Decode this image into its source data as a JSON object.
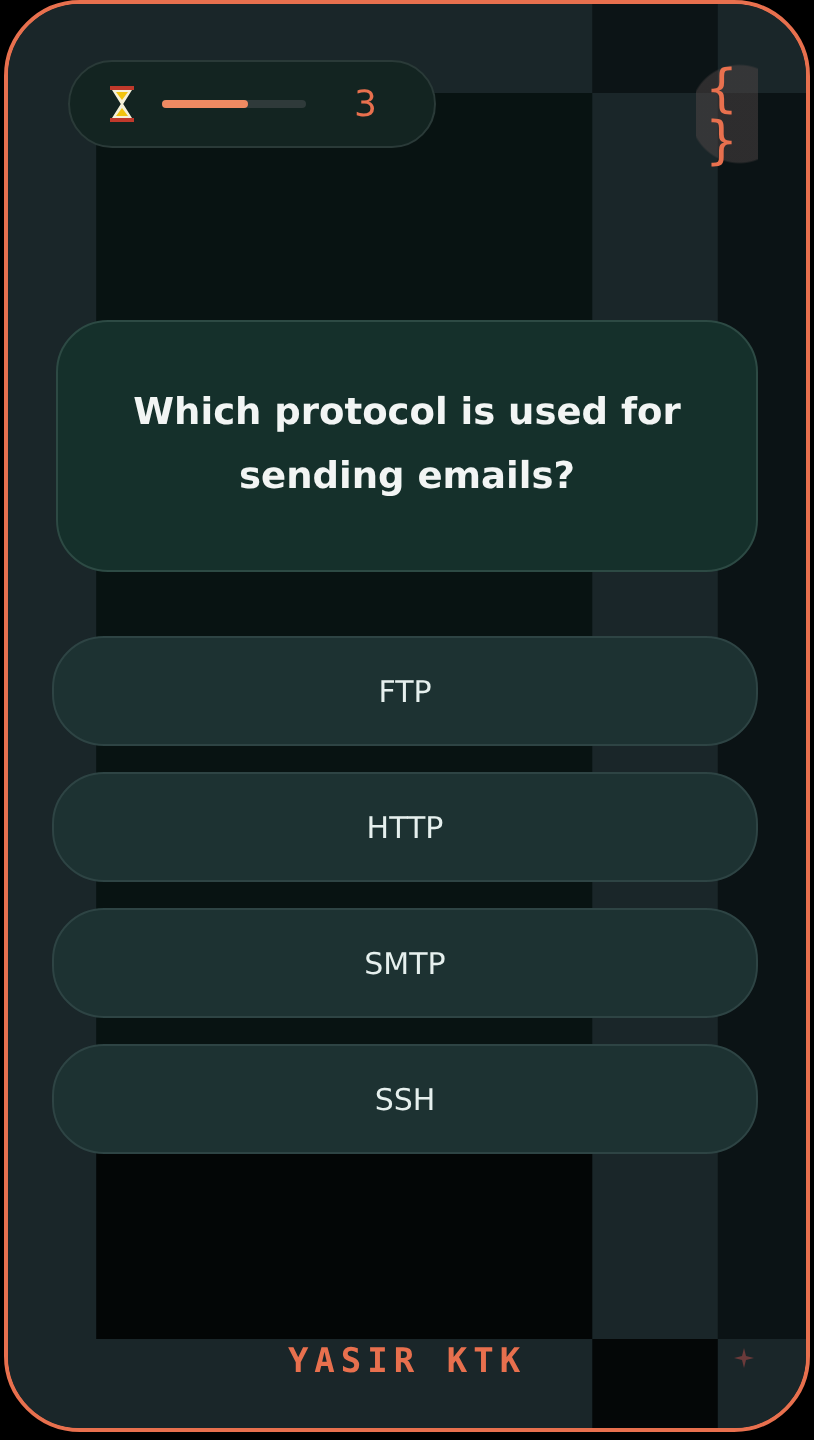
{
  "timer": {
    "level": 0.6,
    "count": "3"
  },
  "logo": {
    "open": "{",
    "close": "}"
  },
  "question": "Which protocol is used for sending emails?",
  "options": [
    {
      "label": "FTP",
      "selected": false
    },
    {
      "label": "HTTP",
      "selected": false
    },
    {
      "label": "SMTP",
      "selected": false
    },
    {
      "label": "SSH",
      "selected": false
    }
  ],
  "footer": "YASIR KTK"
}
